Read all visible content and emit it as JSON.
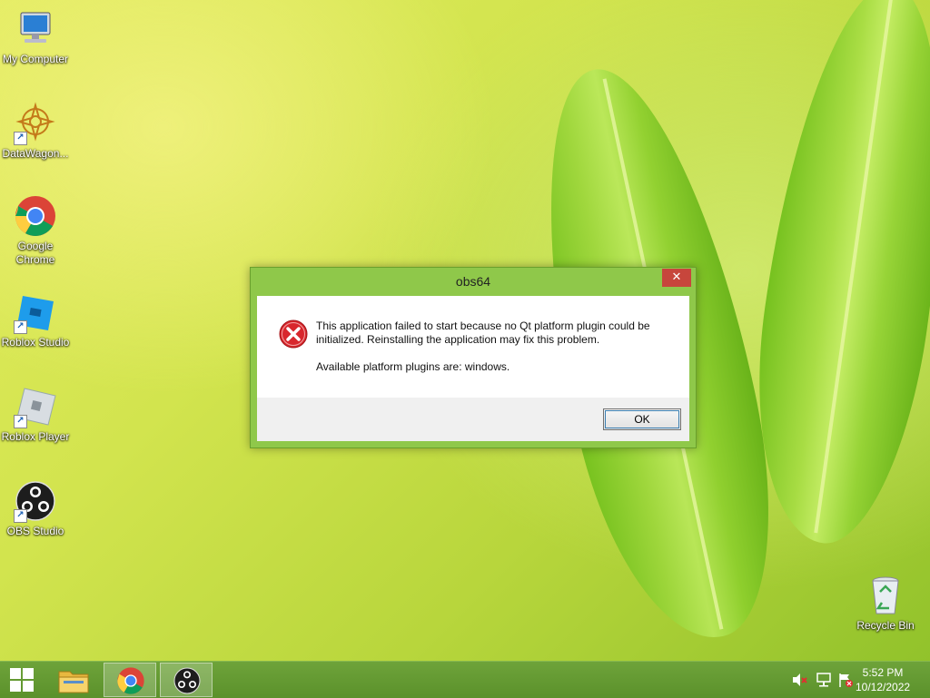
{
  "desktop": {
    "icons": [
      {
        "label": "My Computer"
      },
      {
        "label": "DataWagon..."
      },
      {
        "label": "Google Chrome"
      },
      {
        "label": "Roblox Studio"
      },
      {
        "label": "Roblox Player"
      },
      {
        "label": "OBS Studio"
      },
      {
        "label": "Recycle Bin"
      }
    ]
  },
  "dialog": {
    "title": "obs64",
    "close_label": "✕",
    "message_line1": "This application failed to start because no Qt platform plugin could be initialized. Reinstalling the application may fix this problem.",
    "message_line2": "Available platform plugins are: windows.",
    "ok_label": "OK"
  },
  "taskbar": {
    "items": [
      "start",
      "file-explorer",
      "google-chrome",
      "obs-studio"
    ],
    "active_item": "obs-studio",
    "tray_icons": [
      "volume-muted-icon",
      "network-icon",
      "action-center-flag-icon"
    ],
    "time": "5:52 PM",
    "date": "10/12/2022"
  },
  "colors": {
    "titlebar": "#8fc84a",
    "close_button": "#c7463c",
    "taskbar": "#5b912b",
    "error_icon": "#d8272d"
  }
}
